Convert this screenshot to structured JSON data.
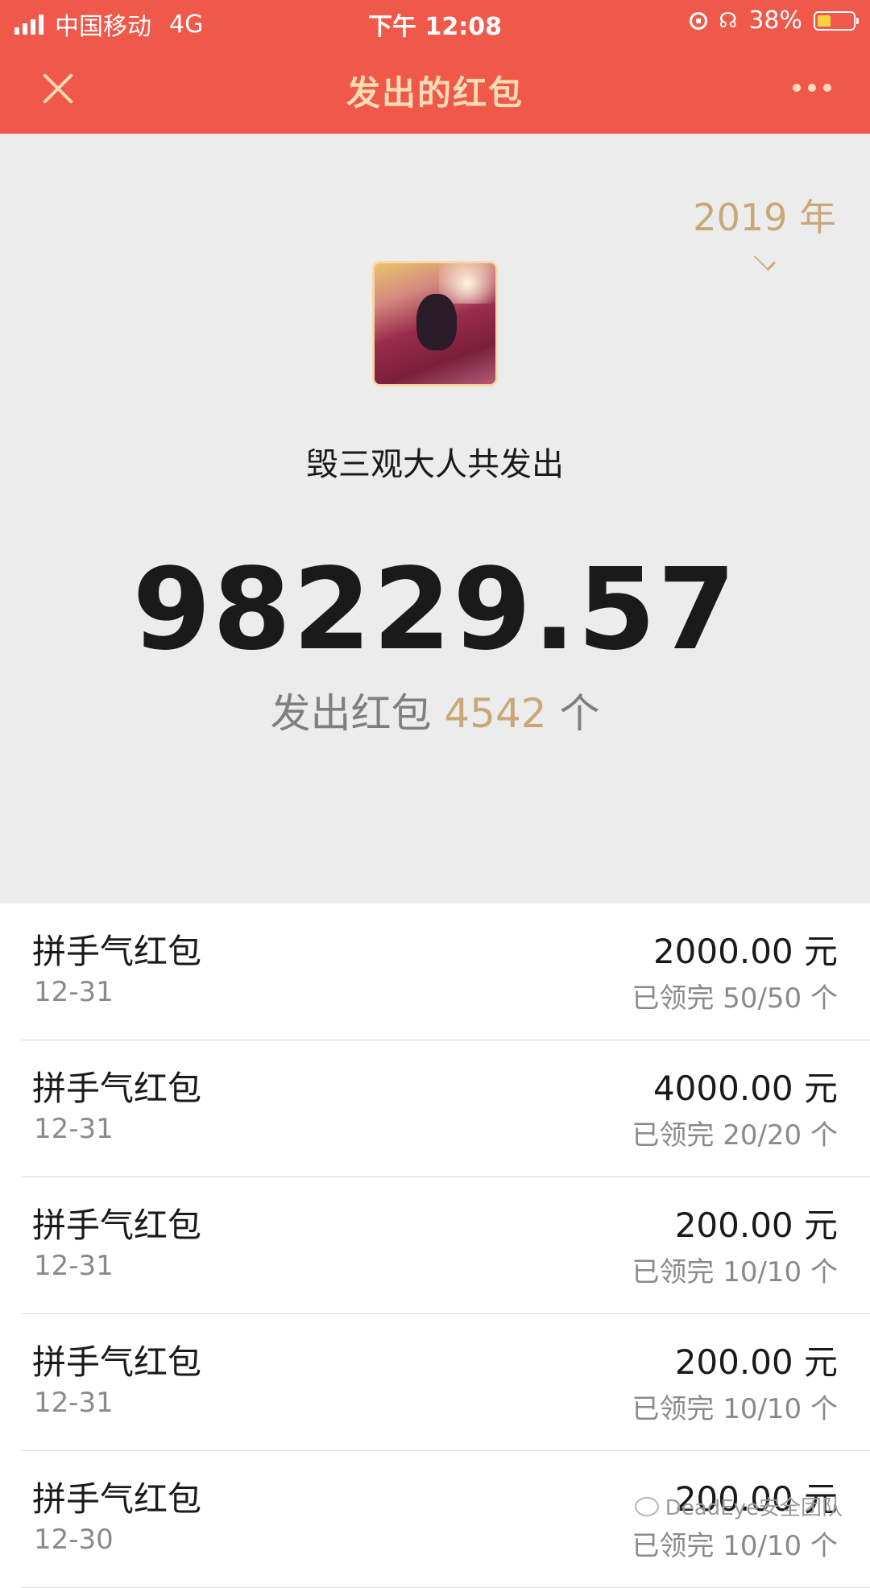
{
  "status_bar": {
    "carrier": "中国移动",
    "network": "4G",
    "time": "下午 12:08",
    "battery": "38%",
    "battery_level": 0.38
  },
  "nav": {
    "title": "发出的红包",
    "close_icon": "close-icon",
    "more_icon": "more-icon"
  },
  "summary": {
    "year": "2019 年",
    "caption": "毁三观大人共发出",
    "total": "98229.57",
    "count_prefix": "发出红包",
    "count": "4542",
    "count_suffix": "个"
  },
  "packets": [
    {
      "type": "拼手气红包",
      "date": "12-31",
      "amount": "2000.00 元",
      "status": "已领完 50/50 个"
    },
    {
      "type": "拼手气红包",
      "date": "12-31",
      "amount": "4000.00 元",
      "status": "已领完 20/20 个"
    },
    {
      "type": "拼手气红包",
      "date": "12-31",
      "amount": "200.00 元",
      "status": "已领完 10/10 个"
    },
    {
      "type": "拼手气红包",
      "date": "12-31",
      "amount": "200.00 元",
      "status": "已领完 10/10 个"
    },
    {
      "type": "拼手气红包",
      "date": "12-30",
      "amount": "200.00 元",
      "status": "已领完 10/10 个"
    }
  ],
  "watermark": "DeadEye安全团队",
  "colors": {
    "header_red": "#f0594a",
    "gold": "#c9a878",
    "title_gold": "#f8dcb5",
    "summary_bg": "#ececec"
  }
}
